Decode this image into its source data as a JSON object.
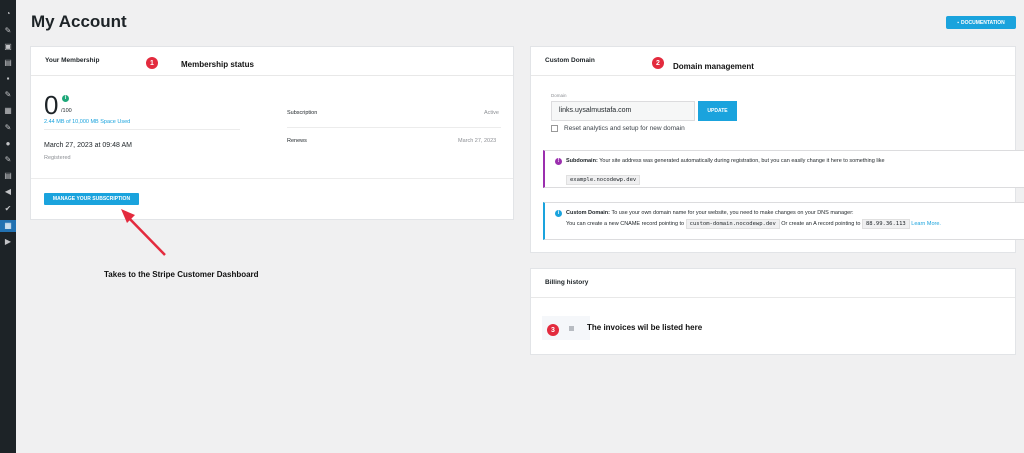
{
  "page": {
    "title": "My Account"
  },
  "header": {
    "documentation_label": "DOCUMENTATION"
  },
  "membership": {
    "title": "Your Membership",
    "usage_value": "0",
    "usage_limit": "/100",
    "space_used": "2.44 MB of 10,000 MB Space Used",
    "registered_date": "March 27, 2023 at 09:48 AM",
    "registered_label": "Registered",
    "subscription_label": "Subscription",
    "subscription_value": "Active",
    "renews_label": "Renews",
    "renews_value": "March 27, 2023",
    "manage_button": "MANAGE YOUR SUBSCRIPTION"
  },
  "domain": {
    "title": "Custom Domain",
    "field_label": "Domain",
    "field_value": "links.uysalmustafa.com",
    "update_button": "UPDATE",
    "reset_label": "Reset analytics and setup for new domain",
    "subdomain_notice": {
      "label": "Subdomain:",
      "text": "Your site address was generated automatically during registration, but you can easily change it here to something like",
      "example": "example.nocodewp.dev"
    },
    "custom_notice": {
      "label": "Custom Domain:",
      "text": "To use your own domain name for your website, you need to make changes on your DNS manager:",
      "line2_a": "You can create a new CNAME record pointing to",
      "cname": "custom-domain.nocodewp.dev",
      "line2_b": "Or create an A record pointing to",
      "ip": "88.99.36.113",
      "learn_more": "Learn More."
    }
  },
  "billing": {
    "title": "Billing history"
  },
  "annotations": {
    "a1": {
      "num": "1",
      "text": "Membership status"
    },
    "a2": {
      "num": "2",
      "text": "Domain management"
    },
    "a3": {
      "num": "3",
      "text": "The invoices wil be listed here"
    },
    "arrow": "Takes to the Stripe Customer Dashboard"
  },
  "colors": {
    "accent": "#1aa3dd",
    "badge": "#e32b3e",
    "sidebar": "#1d2327"
  }
}
